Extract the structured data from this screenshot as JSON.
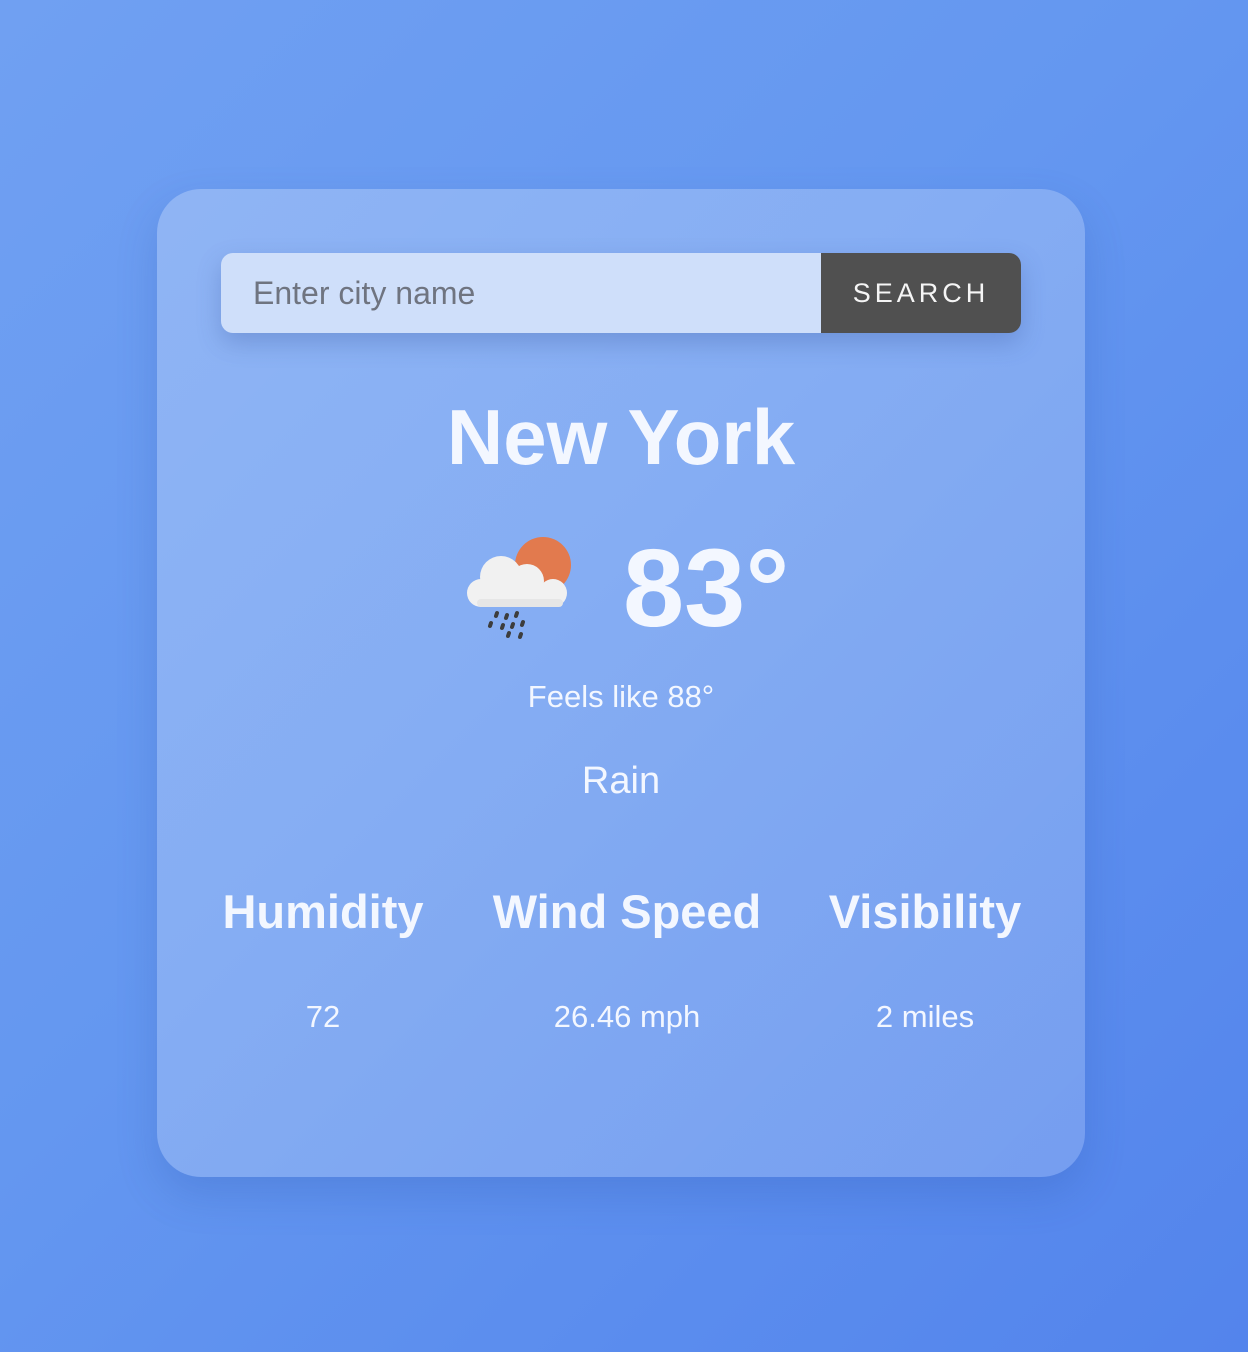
{
  "search": {
    "placeholder": "Enter city name",
    "value": "",
    "button_label": "SEARCH"
  },
  "weather": {
    "city": "New York",
    "temperature": "83°",
    "feels_like": "Feels like 88°",
    "condition": "Rain",
    "icon": "sun-behind-rain-cloud-icon"
  },
  "stats": {
    "humidity": {
      "label": "Humidity",
      "value": "72"
    },
    "wind_speed": {
      "label": "Wind Speed",
      "value": "26.46 mph"
    },
    "visibility": {
      "label": "Visibility",
      "value": "2 miles"
    }
  },
  "colors": {
    "background_start": "#70a0f2",
    "background_end": "#5384ec",
    "input_background": "#cfdffa",
    "button_background": "#505050",
    "text": "#f3f7ff",
    "sun": "#e27a4e"
  }
}
